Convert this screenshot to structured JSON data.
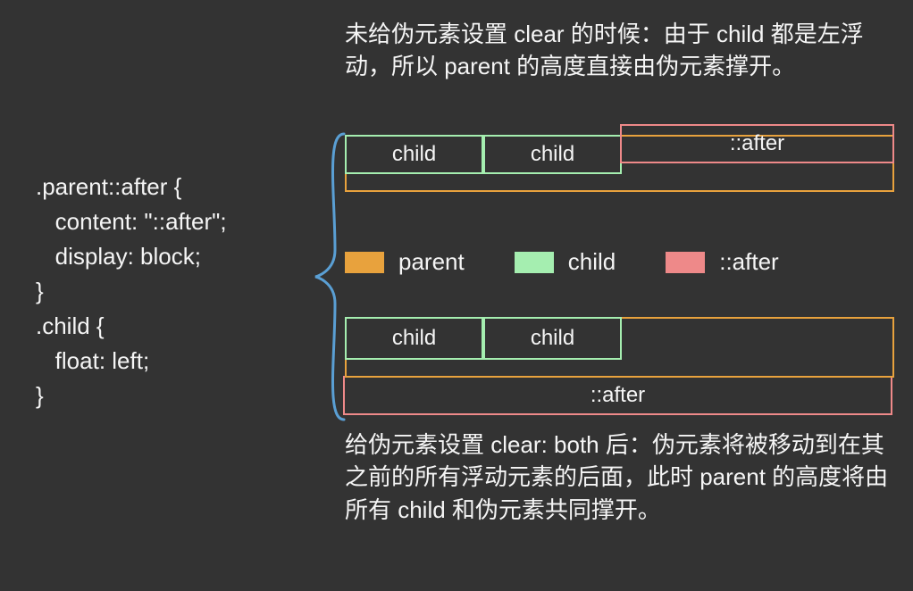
{
  "code": ".parent::after {\n   content: \"::after\";\n   display: block;\n}\n.child {\n   float: left;\n}",
  "explain_top": "未给伪元素设置 clear 的时候：由于 child 都是左浮动，所以 parent 的高度直接由伪元素撑开。",
  "explain_bottom": "给伪元素设置 clear: both 后：伪元素将被移动到在其之前的所有浮动元素的后面，此时 parent  的高度将由所有 child 和伪元素共同撑开。",
  "labels": {
    "child": "child",
    "after": "::after",
    "parent": "parent"
  },
  "legend": {
    "parent": "parent",
    "child": "child",
    "after": "::after"
  },
  "colors": {
    "parent": "#e8a23d",
    "child": "#a5eeb0",
    "after": "#ee8989"
  }
}
